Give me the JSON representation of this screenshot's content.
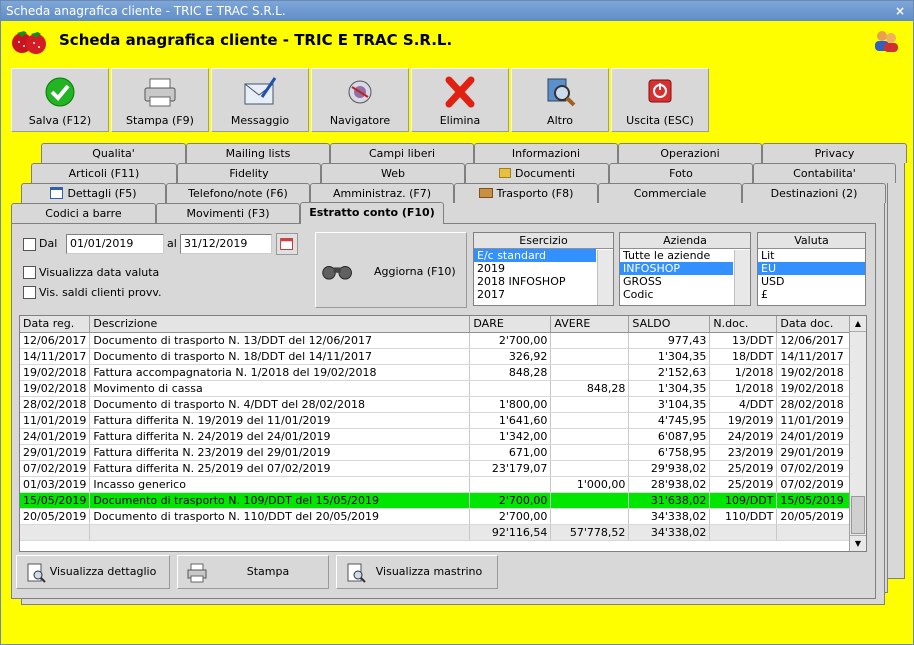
{
  "window": {
    "title": "Scheda anagrafica cliente - TRIC E TRAC S.R.L.",
    "close": "×"
  },
  "header": {
    "title": "Scheda anagrafica cliente - TRIC E TRAC S.R.L."
  },
  "toolbar": [
    {
      "label": "Salva (F12)",
      "icon": "check-icon"
    },
    {
      "label": "Stampa (F9)",
      "icon": "printer-icon"
    },
    {
      "label": "Messaggio",
      "icon": "envelope-icon"
    },
    {
      "label": "Navigatore",
      "icon": "compass-icon"
    },
    {
      "label": "Elimina",
      "icon": "delete-icon"
    },
    {
      "label": "Altro",
      "icon": "magnifier-icon"
    },
    {
      "label": "Uscita (ESC)",
      "icon": "exit-icon"
    }
  ],
  "tabs": {
    "row1": [
      "Qualita'",
      "Mailing lists",
      "Campi liberi",
      "Informazioni",
      "Operazioni",
      "Privacy"
    ],
    "row2": [
      "Articoli (F11)",
      "Fidelity",
      "Web",
      "Documenti",
      "Foto",
      "Contabilita'"
    ],
    "row3": [
      "Dettagli (F5)",
      "Telefono/note (F6)",
      "Amministraz. (F7)",
      "Trasporto (F8)",
      "Commerciale",
      "Destinazioni (2)"
    ],
    "row4": [
      "Codici a barre",
      "Movimenti (F3)",
      "Estratto conto (F10)"
    ]
  },
  "filters": {
    "dal_label": "Dal",
    "dal_value": "01/01/2019",
    "al_label": "al",
    "al_value": "31/12/2019",
    "data_valuta": "Visualizza data valuta",
    "saldi_provv": "Vis. saldi clienti provv.",
    "aggiorna": "Aggiorna (F10)"
  },
  "esercizio": {
    "header": "Esercizio",
    "items": [
      "E/c standard",
      "2019",
      "2018 INFOSHOP",
      "2017"
    ],
    "selected": 0
  },
  "azienda": {
    "header": "Azienda",
    "items": [
      "Tutte le aziende",
      "INFOSHOP",
      "GROSS",
      "Codic"
    ],
    "selected": 1
  },
  "valuta": {
    "header": "Valuta",
    "items": [
      "Lit",
      "EU",
      "USD",
      "£"
    ],
    "selected": 1
  },
  "grid": {
    "columns": [
      "Data reg.",
      "Descrizione",
      "DARE",
      "AVERE",
      "SALDO",
      "N.doc.",
      "Data doc."
    ],
    "rows": [
      [
        "12/06/2017",
        "Documento di trasporto N. 13/DDT del 12/06/2017",
        "2'700,00",
        "",
        "977,43",
        "13/DDT",
        "12/06/2017"
      ],
      [
        "14/11/2017",
        "Documento di trasporto N. 18/DDT del 14/11/2017",
        "326,92",
        "",
        "1'304,35",
        "18/DDT",
        "14/11/2017"
      ],
      [
        "19/02/2018",
        "Fattura accompagnatoria N. 1/2018 del 19/02/2018",
        "848,28",
        "",
        "2'152,63",
        "1/2018",
        "19/02/2018"
      ],
      [
        "19/02/2018",
        "Movimento di cassa",
        "",
        "848,28",
        "1'304,35",
        "1/2018",
        "19/02/2018"
      ],
      [
        "28/02/2018",
        "Documento di trasporto N. 4/DDT del 28/02/2018",
        "1'800,00",
        "",
        "3'104,35",
        "4/DDT",
        "28/02/2018"
      ],
      [
        "11/01/2019",
        "Fattura differita N. 19/2019 del 11/01/2019",
        "1'641,60",
        "",
        "4'745,95",
        "19/2019",
        "11/01/2019"
      ],
      [
        "24/01/2019",
        "Fattura differita N. 24/2019 del 24/01/2019",
        "1'342,00",
        "",
        "6'087,95",
        "24/2019",
        "24/01/2019"
      ],
      [
        "29/01/2019",
        "Fattura differita N. 23/2019 del 29/01/2019",
        "671,00",
        "",
        "6'758,95",
        "23/2019",
        "29/01/2019"
      ],
      [
        "07/02/2019",
        "Fattura differita N. 25/2019 del 07/02/2019",
        "23'179,07",
        "",
        "29'938,02",
        "25/2019",
        "07/02/2019"
      ],
      [
        "01/03/2019",
        "Incasso generico",
        "",
        "1'000,00",
        "28'938,02",
        "25/2019",
        "07/02/2019"
      ],
      [
        "15/05/2019",
        "Documento di trasporto N. 109/DDT del 15/05/2019",
        "2'700,00",
        "",
        "31'638,02",
        "109/DDT",
        "15/05/2019"
      ],
      [
        "20/05/2019",
        "Documento di trasporto N. 110/DDT del 20/05/2019",
        "2'700,00",
        "",
        "34'338,02",
        "110/DDT",
        "20/05/2019"
      ]
    ],
    "highlight_row": 10,
    "totals": [
      "",
      "",
      "92'116,54",
      "57'778,52",
      "34'338,02",
      "",
      ""
    ]
  },
  "bottom": {
    "dettaglio": "Visualizza dettaglio",
    "stampa": "Stampa",
    "mastrino": "Visualizza mastrino"
  },
  "colors": {
    "background": "#fefe00",
    "highlight": "#00e600",
    "selection": "#3390ff",
    "titlebar": "#6b97cf"
  }
}
